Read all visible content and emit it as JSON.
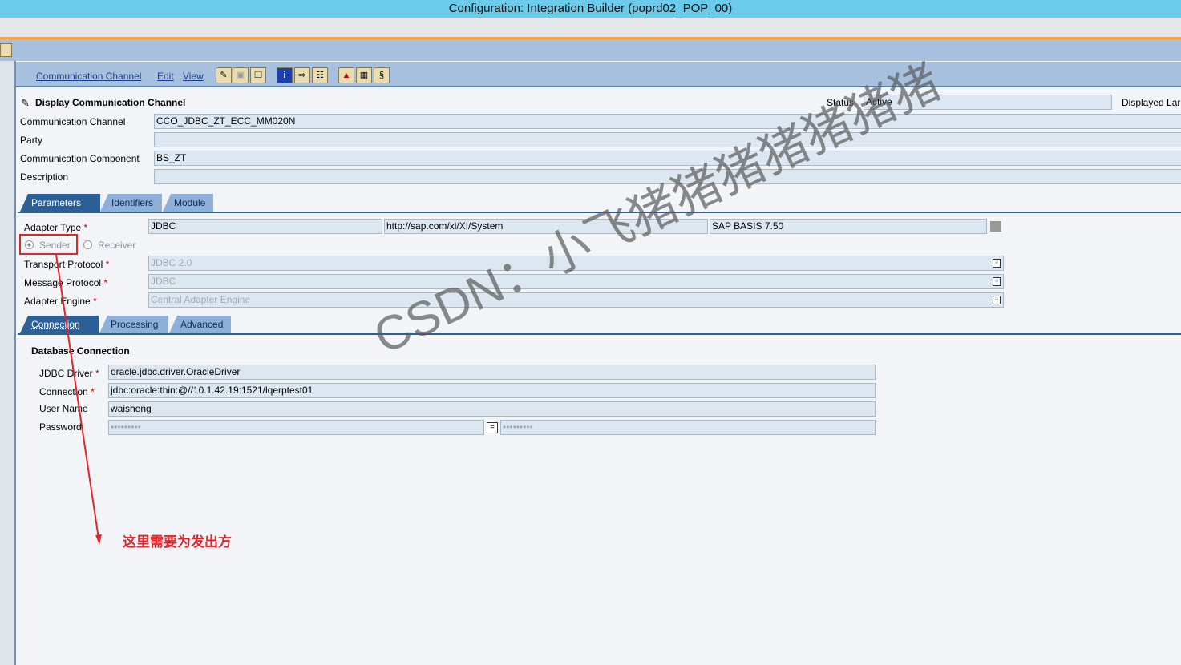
{
  "window_title": "Configuration: Integration Builder (poprd02_POP_00)",
  "menu": [
    "Communication Channel",
    "Edit",
    "View"
  ],
  "header": {
    "title": "Display Communication Channel",
    "status_label": "Status",
    "status_value": "Active",
    "displayed_label": "Displayed Lar"
  },
  "fields": [
    {
      "label": "Communication Channel",
      "value": "CCO_JDBC_ZT_ECC_MM020N"
    },
    {
      "label": "Party",
      "value": ""
    },
    {
      "label": "Communication Component",
      "value": "BS_ZT"
    },
    {
      "label": "Description",
      "value": ""
    }
  ],
  "tabs": [
    "Parameters",
    "Identifiers",
    "Module"
  ],
  "adapter": {
    "type_label": "Adapter Type",
    "type": "JDBC",
    "namespace": "http://sap.com/xi/XI/System",
    "swcv": "SAP BASIS 7.50",
    "sender": "Sender",
    "receiver": "Receiver",
    "selected": "Sender",
    "transport_label": "Transport Protocol",
    "transport": "JDBC 2.0",
    "message_label": "Message Protocol",
    "message": "JDBC",
    "engine_label": "Adapter Engine",
    "engine": "Central Adapter Engine"
  },
  "subtabs": [
    "Connection",
    "Processing",
    "Advanced"
  ],
  "db": {
    "section": "Database Connection",
    "driver_label": "JDBC Driver",
    "driver": "oracle.jdbc.driver.OracleDriver",
    "conn_label": "Connection",
    "conn": "jdbc:oracle:thin:@//10.1.42.19:1521/lqerptest01",
    "user_label": "User Name",
    "user": "waisheng",
    "pw_label": "Password",
    "pw": "•••••••••",
    "pw2": "•••••••••"
  },
  "annotation": "这里需要为发出方",
  "watermark": "CSDN：小飞猪猪猪猪猪猪猪",
  "colors": {
    "title_bar": "#6ccbea",
    "annotation": "#e0262a",
    "active_tab": "#2c5f95"
  }
}
